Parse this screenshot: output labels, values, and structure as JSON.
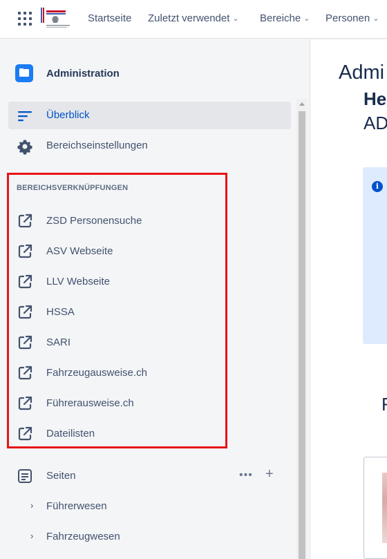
{
  "nav": {
    "items": [
      {
        "label": "Startseite",
        "has_dropdown": false
      },
      {
        "label": "Zuletzt verwendet",
        "has_dropdown": true
      },
      {
        "label": "Bereiche",
        "has_dropdown": true
      },
      {
        "label": "Personen",
        "has_dropdown": true
      }
    ]
  },
  "sidebar": {
    "space_title": "Administration",
    "menu": [
      {
        "label": "Überblick",
        "icon": "overview-icon",
        "active": true
      },
      {
        "label": "Bereichseinstellungen",
        "icon": "gear-icon",
        "active": false
      }
    ],
    "shortcuts_title": "BEREICHSVERKNÜPFUNGEN",
    "shortcuts": [
      {
        "label": "ZSD Personensuche"
      },
      {
        "label": "ASV Webseite"
      },
      {
        "label": "LLV Webseite"
      },
      {
        "label": "HSSA"
      },
      {
        "label": "SARI"
      },
      {
        "label": "Fahrzeugausweise.ch"
      },
      {
        "label": "Führerausweise.ch"
      },
      {
        "label": "Dateilisten"
      }
    ],
    "pages_label": "Seiten",
    "tree": [
      {
        "label": "Führerwesen"
      },
      {
        "label": "Fahrzeugwesen"
      }
    ]
  },
  "main": {
    "title": "Admi",
    "subtitle_bold": "He",
    "subtitle": "AD",
    "letter": "F"
  },
  "colors": {
    "accent": "#0052cc",
    "highlight": "#e81414",
    "sidebar_bg": "#f4f5f7",
    "info_bg": "#deebff"
  }
}
